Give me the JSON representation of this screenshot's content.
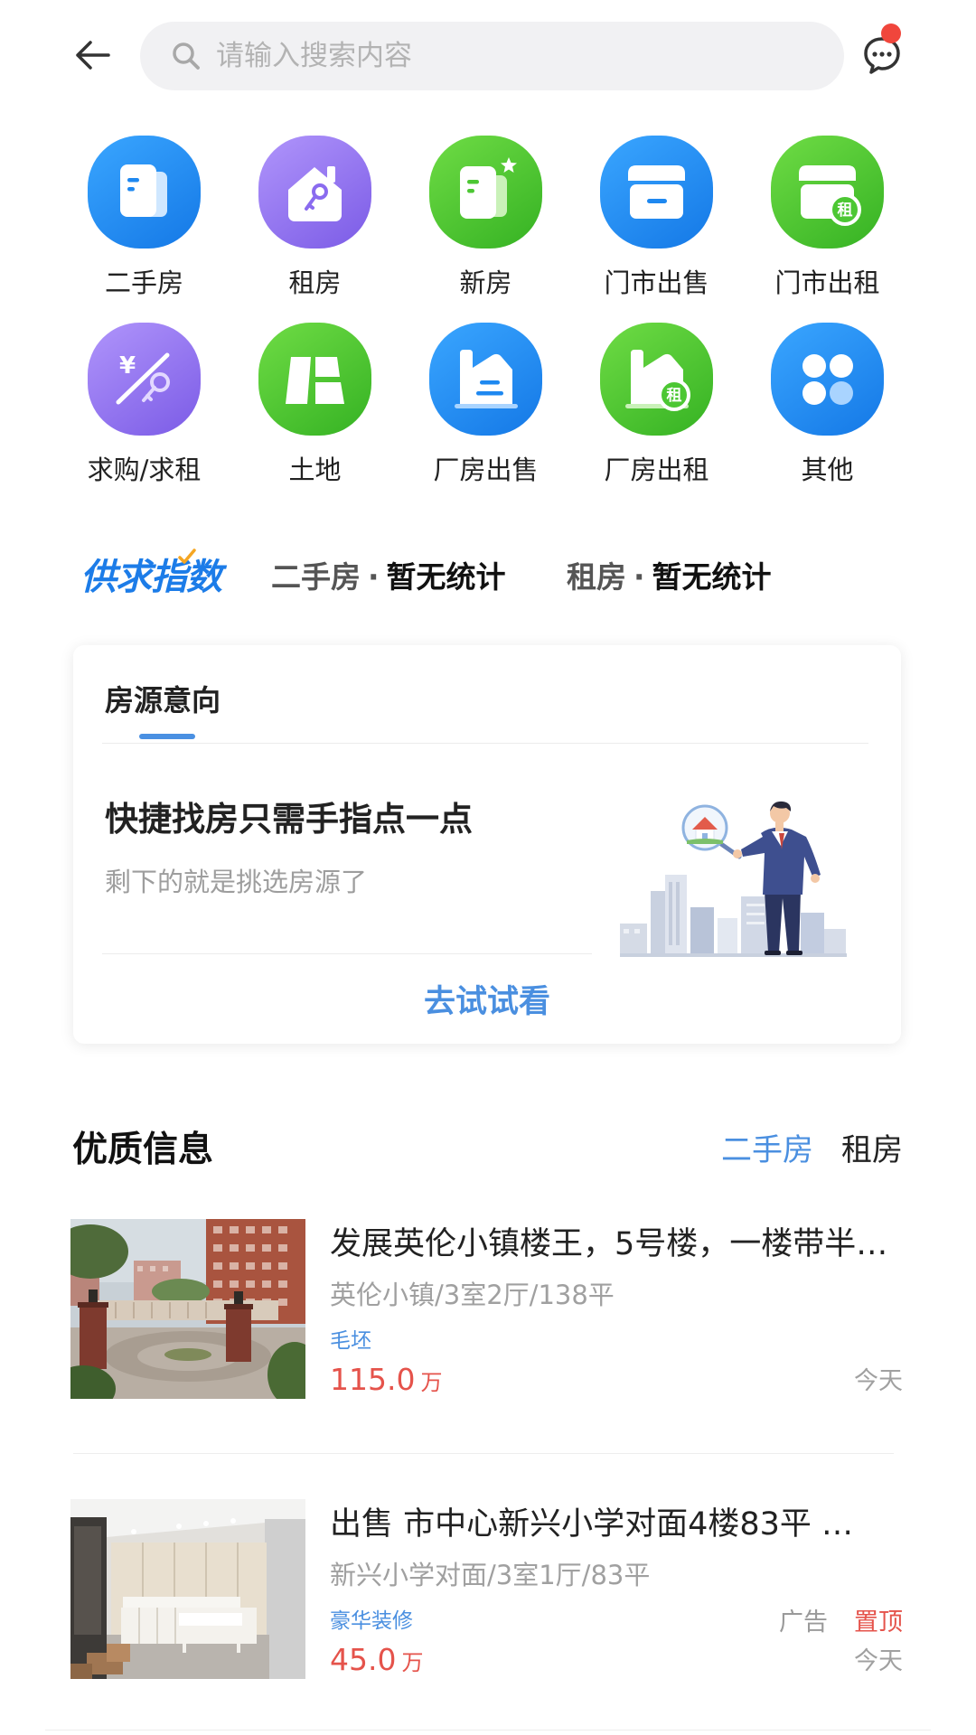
{
  "header": {
    "back_icon": "back-arrow-icon",
    "search_icon": "search-icon",
    "search_placeholder": "请输入搜索内容",
    "message_icon": "chat-bubble-icon",
    "unread_dot": true
  },
  "categories": [
    {
      "label": "二手房",
      "icon": "document-stack-icon",
      "color": "#1E88F0"
    },
    {
      "label": "租房",
      "icon": "house-key-icon",
      "color": "#8A6BEF"
    },
    {
      "label": "新房",
      "icon": "document-star-icon",
      "color": "#4CC733"
    },
    {
      "label": "门市出售",
      "icon": "storefront-icon",
      "color": "#1E88F0"
    },
    {
      "label": "门市出租",
      "icon": "storefront-rent-icon",
      "color": "#4CC733",
      "badge": "租"
    },
    {
      "label": "求购/求租",
      "icon": "yuan-key-icon",
      "color": "#8A6BEF",
      "badge": "¥"
    },
    {
      "label": "土地",
      "icon": "land-plots-icon",
      "color": "#4CC733"
    },
    {
      "label": "厂房出售",
      "icon": "factory-icon",
      "color": "#1E88F0"
    },
    {
      "label": "厂房出租",
      "icon": "factory-rent-icon",
      "color": "#4CC733",
      "badge": "租"
    },
    {
      "label": "其他",
      "icon": "four-dots-icon",
      "color": "#1E88F0"
    }
  ],
  "supply_index": {
    "logo_text": "供求指数",
    "stats": [
      {
        "category": "二手房",
        "separator": "·",
        "value": "暂无统计"
      },
      {
        "category": "租房",
        "separator": "·",
        "value": "暂无统计"
      }
    ]
  },
  "intent_card": {
    "tab": "房源意向",
    "headline": "快捷找房只需手指点一点",
    "subline": "剩下的就是挑选房源了",
    "action": "去试试看"
  },
  "quality": {
    "title": "优质信息",
    "tabs": [
      {
        "label": "二手房",
        "active": true
      },
      {
        "label": "租房",
        "active": false
      }
    ],
    "listings": [
      {
        "title": "发展英伦小镇楼王，5号楼，一楼带半…",
        "subtitle": "英伦小镇/3室2厅/138平",
        "tag": "毛坯",
        "price": "115.0",
        "unit": "万",
        "date": "今天"
      },
      {
        "title": "出售 市中心新兴小学对面4楼83平 …",
        "subtitle": "新兴小学对面/3室1厅/83平",
        "tag": "豪华装修",
        "price": "45.0",
        "unit": "万",
        "ad_label": "广告",
        "pinned_label": "置顶",
        "date": "今天"
      }
    ]
  },
  "colors": {
    "accent_blue": "#4A8FE0",
    "price_red": "#E5534B",
    "unread_red": "#F0463C",
    "muted_gray": "#A0A0A0"
  }
}
